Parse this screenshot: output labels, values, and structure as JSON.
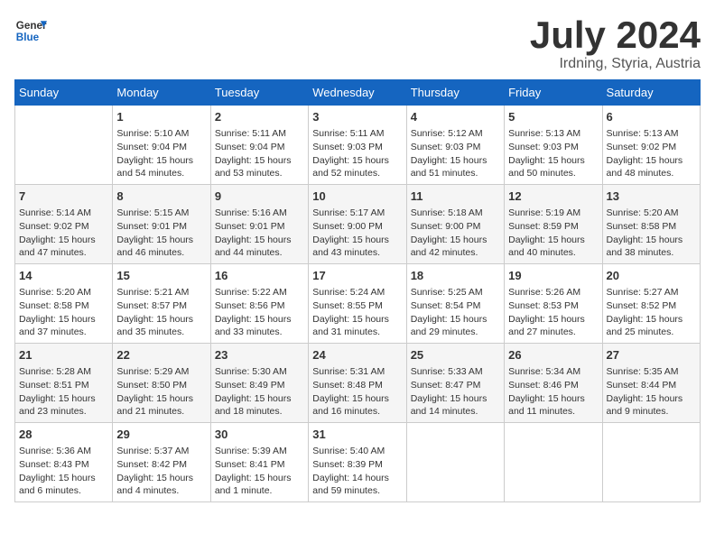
{
  "header": {
    "logo_general": "General",
    "logo_blue": "Blue",
    "month": "July 2024",
    "location": "Irdning, Styria, Austria"
  },
  "weekdays": [
    "Sunday",
    "Monday",
    "Tuesday",
    "Wednesday",
    "Thursday",
    "Friday",
    "Saturday"
  ],
  "weeks": [
    [
      {
        "day": "",
        "info": ""
      },
      {
        "day": "1",
        "info": "Sunrise: 5:10 AM\nSunset: 9:04 PM\nDaylight: 15 hours\nand 54 minutes."
      },
      {
        "day": "2",
        "info": "Sunrise: 5:11 AM\nSunset: 9:04 PM\nDaylight: 15 hours\nand 53 minutes."
      },
      {
        "day": "3",
        "info": "Sunrise: 5:11 AM\nSunset: 9:03 PM\nDaylight: 15 hours\nand 52 minutes."
      },
      {
        "day": "4",
        "info": "Sunrise: 5:12 AM\nSunset: 9:03 PM\nDaylight: 15 hours\nand 51 minutes."
      },
      {
        "day": "5",
        "info": "Sunrise: 5:13 AM\nSunset: 9:03 PM\nDaylight: 15 hours\nand 50 minutes."
      },
      {
        "day": "6",
        "info": "Sunrise: 5:13 AM\nSunset: 9:02 PM\nDaylight: 15 hours\nand 48 minutes."
      }
    ],
    [
      {
        "day": "7",
        "info": "Sunrise: 5:14 AM\nSunset: 9:02 PM\nDaylight: 15 hours\nand 47 minutes."
      },
      {
        "day": "8",
        "info": "Sunrise: 5:15 AM\nSunset: 9:01 PM\nDaylight: 15 hours\nand 46 minutes."
      },
      {
        "day": "9",
        "info": "Sunrise: 5:16 AM\nSunset: 9:01 PM\nDaylight: 15 hours\nand 44 minutes."
      },
      {
        "day": "10",
        "info": "Sunrise: 5:17 AM\nSunset: 9:00 PM\nDaylight: 15 hours\nand 43 minutes."
      },
      {
        "day": "11",
        "info": "Sunrise: 5:18 AM\nSunset: 9:00 PM\nDaylight: 15 hours\nand 42 minutes."
      },
      {
        "day": "12",
        "info": "Sunrise: 5:19 AM\nSunset: 8:59 PM\nDaylight: 15 hours\nand 40 minutes."
      },
      {
        "day": "13",
        "info": "Sunrise: 5:20 AM\nSunset: 8:58 PM\nDaylight: 15 hours\nand 38 minutes."
      }
    ],
    [
      {
        "day": "14",
        "info": "Sunrise: 5:20 AM\nSunset: 8:58 PM\nDaylight: 15 hours\nand 37 minutes."
      },
      {
        "day": "15",
        "info": "Sunrise: 5:21 AM\nSunset: 8:57 PM\nDaylight: 15 hours\nand 35 minutes."
      },
      {
        "day": "16",
        "info": "Sunrise: 5:22 AM\nSunset: 8:56 PM\nDaylight: 15 hours\nand 33 minutes."
      },
      {
        "day": "17",
        "info": "Sunrise: 5:24 AM\nSunset: 8:55 PM\nDaylight: 15 hours\nand 31 minutes."
      },
      {
        "day": "18",
        "info": "Sunrise: 5:25 AM\nSunset: 8:54 PM\nDaylight: 15 hours\nand 29 minutes."
      },
      {
        "day": "19",
        "info": "Sunrise: 5:26 AM\nSunset: 8:53 PM\nDaylight: 15 hours\nand 27 minutes."
      },
      {
        "day": "20",
        "info": "Sunrise: 5:27 AM\nSunset: 8:52 PM\nDaylight: 15 hours\nand 25 minutes."
      }
    ],
    [
      {
        "day": "21",
        "info": "Sunrise: 5:28 AM\nSunset: 8:51 PM\nDaylight: 15 hours\nand 23 minutes."
      },
      {
        "day": "22",
        "info": "Sunrise: 5:29 AM\nSunset: 8:50 PM\nDaylight: 15 hours\nand 21 minutes."
      },
      {
        "day": "23",
        "info": "Sunrise: 5:30 AM\nSunset: 8:49 PM\nDaylight: 15 hours\nand 18 minutes."
      },
      {
        "day": "24",
        "info": "Sunrise: 5:31 AM\nSunset: 8:48 PM\nDaylight: 15 hours\nand 16 minutes."
      },
      {
        "day": "25",
        "info": "Sunrise: 5:33 AM\nSunset: 8:47 PM\nDaylight: 15 hours\nand 14 minutes."
      },
      {
        "day": "26",
        "info": "Sunrise: 5:34 AM\nSunset: 8:46 PM\nDaylight: 15 hours\nand 11 minutes."
      },
      {
        "day": "27",
        "info": "Sunrise: 5:35 AM\nSunset: 8:44 PM\nDaylight: 15 hours\nand 9 minutes."
      }
    ],
    [
      {
        "day": "28",
        "info": "Sunrise: 5:36 AM\nSunset: 8:43 PM\nDaylight: 15 hours\nand 6 minutes."
      },
      {
        "day": "29",
        "info": "Sunrise: 5:37 AM\nSunset: 8:42 PM\nDaylight: 15 hours\nand 4 minutes."
      },
      {
        "day": "30",
        "info": "Sunrise: 5:39 AM\nSunset: 8:41 PM\nDaylight: 15 hours\nand 1 minute."
      },
      {
        "day": "31",
        "info": "Sunrise: 5:40 AM\nSunset: 8:39 PM\nDaylight: 14 hours\nand 59 minutes."
      },
      {
        "day": "",
        "info": ""
      },
      {
        "day": "",
        "info": ""
      },
      {
        "day": "",
        "info": ""
      }
    ]
  ]
}
